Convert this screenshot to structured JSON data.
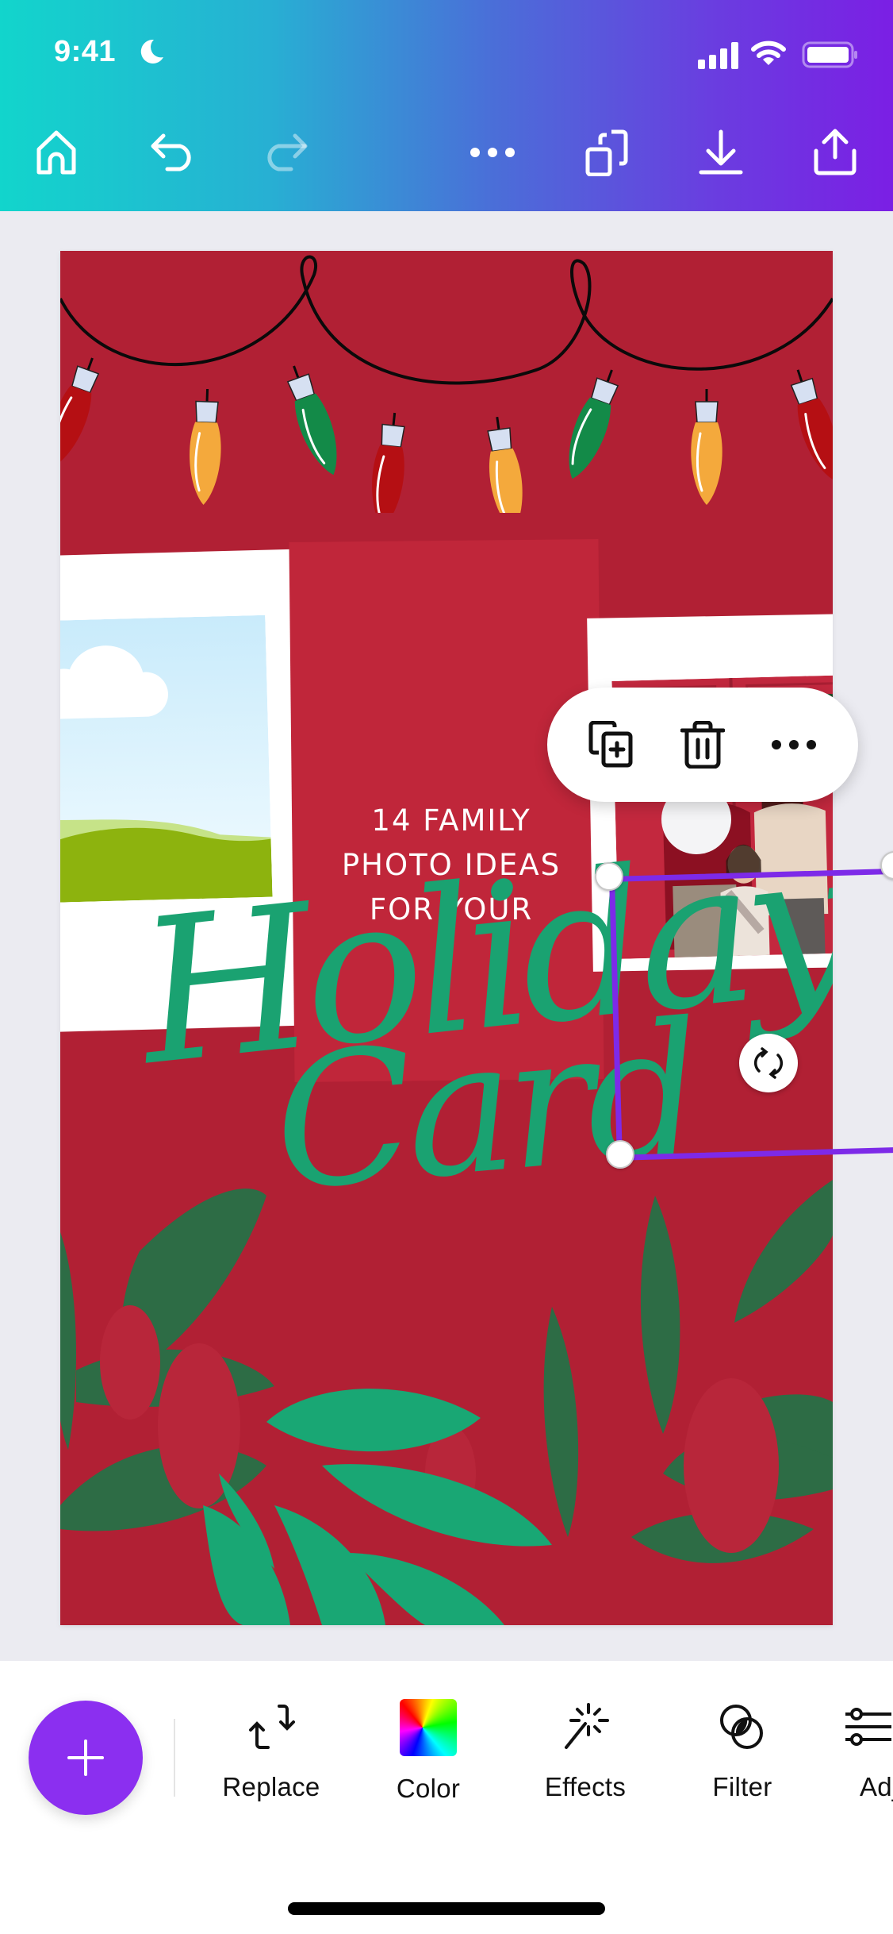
{
  "status_bar": {
    "time": "9:41",
    "focus_mode_icon": "moon-icon",
    "signal_icon": "cellular-signal-icon",
    "wifi_icon": "wifi-icon",
    "battery_icon": "battery-icon"
  },
  "header": {
    "gradient_start": "#12d5cc",
    "gradient_end": "#7b1fe4",
    "buttons": [
      {
        "name": "home",
        "icon": "home-icon"
      },
      {
        "name": "undo",
        "icon": "undo-icon"
      },
      {
        "name": "redo",
        "icon": "redo-icon",
        "disabled": true
      },
      {
        "name": "more",
        "icon": "more-horizontal-icon"
      },
      {
        "name": "pages",
        "icon": "pages-icon"
      },
      {
        "name": "download",
        "icon": "download-icon"
      },
      {
        "name": "share",
        "icon": "share-icon"
      }
    ]
  },
  "design": {
    "background_color": "#b12034",
    "headline_lines": [
      "14 FAMILY",
      "PHOTO IDEAS",
      "FOR YOUR"
    ],
    "script_title_line1": "Holiday",
    "script_title_line2": "Card",
    "script_color": "#1aa271",
    "light_bulb_colors": [
      "#b50f13",
      "#f4a93c",
      "#138a48",
      "#b50f13",
      "#f4a93c",
      "#138a48",
      "#f4a93c",
      "#b50f13"
    ],
    "left_photo": "placeholder landscape with cloud and hills",
    "right_photo": "family portrait in front of red door with wreaths"
  },
  "selection": {
    "color": "#7d2ae8",
    "context_menu": [
      {
        "name": "duplicate",
        "icon": "duplicate-icon"
      },
      {
        "name": "delete",
        "icon": "trash-icon"
      },
      {
        "name": "more",
        "icon": "more-horizontal-icon"
      }
    ],
    "rotate_icon": "rotate-icon"
  },
  "toolbar": {
    "add_button_color": "#8b2ff0",
    "items": [
      {
        "label": "Replace",
        "icon": "replace-icon"
      },
      {
        "label": "Color",
        "icon": "color-swatch-icon"
      },
      {
        "label": "Effects",
        "icon": "magic-wand-icon"
      },
      {
        "label": "Filter",
        "icon": "filter-icon"
      },
      {
        "label": "Adjust",
        "icon": "adjust-sliders-icon"
      }
    ]
  }
}
